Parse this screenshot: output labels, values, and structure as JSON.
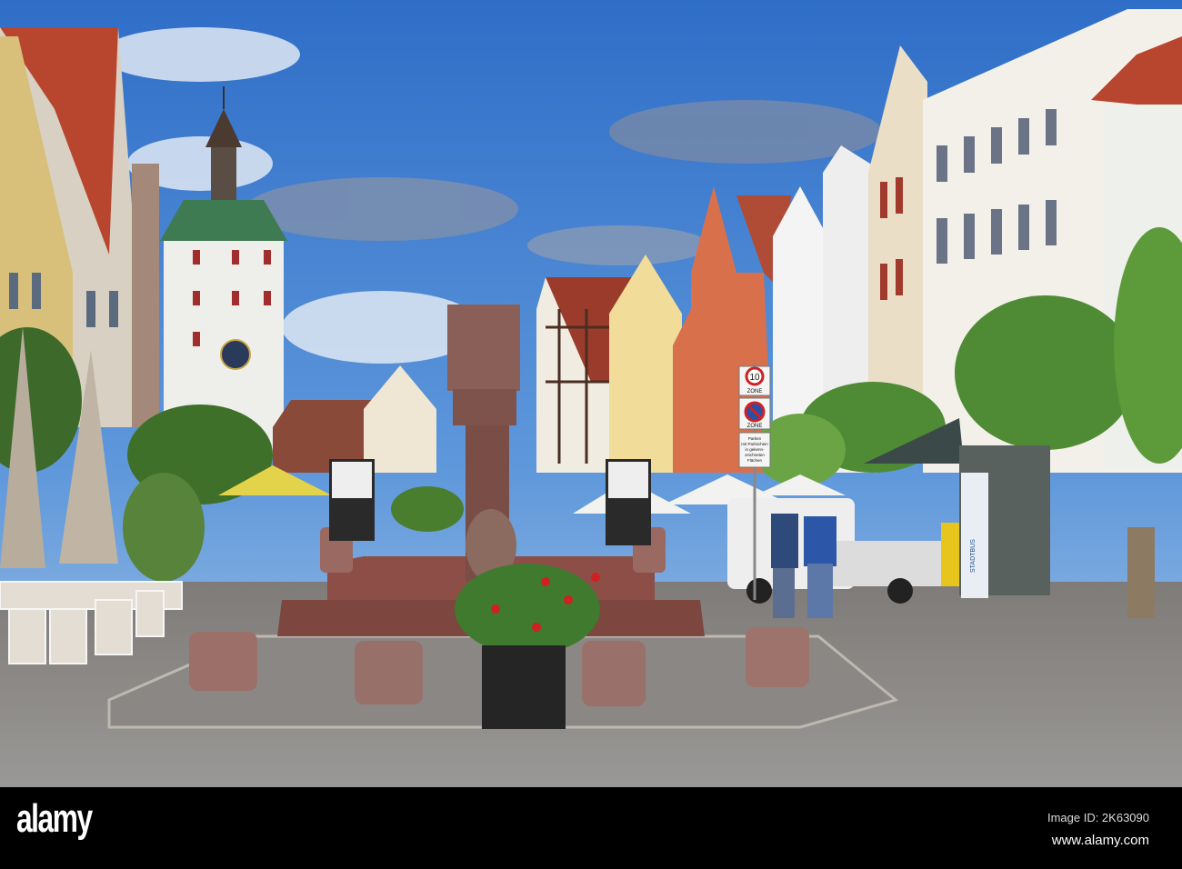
{
  "watermark": {
    "logo": "alamy",
    "image_id": "Image ID: 2K63090",
    "url": "www.alamy.com"
  },
  "signs": {
    "speed_limit": "10",
    "zone_1": "ZONE",
    "zone_2": "ZONE",
    "parking_line1": "Parken",
    "parking_line2": "mit Parkschein",
    "parking_line3": "in gekenn-",
    "parking_line4": "zeichneten",
    "parking_line5": "Flächen",
    "bus": "STADTBUS"
  },
  "colors": {
    "sky": "#3f7fd0",
    "roof": "#b8452e",
    "granite": "#8a5a52",
    "cobble": "#8c8c8c"
  }
}
